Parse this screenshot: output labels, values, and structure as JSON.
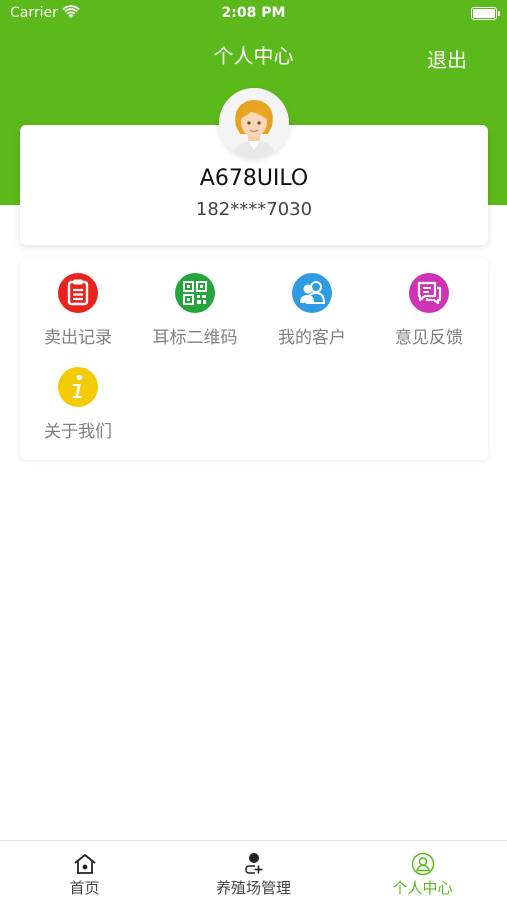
{
  "status_bar": {
    "carrier": "Carrier",
    "time": "2:08 PM"
  },
  "header": {
    "title": "个人中心",
    "logout_label": "退出",
    "color": "#5cb91b"
  },
  "profile": {
    "avatar_icon": "user-avatar-icon",
    "username": "A678UILO",
    "phone": "182****7030"
  },
  "menu": {
    "items": [
      {
        "label": "卖出记录",
        "icon": "clipboard-icon",
        "color": "#e8241c"
      },
      {
        "label": "耳标二维码",
        "icon": "qrcode-icon",
        "color": "#27a53d"
      },
      {
        "label": "我的客户",
        "icon": "customers-icon",
        "color": "#2e9be3"
      },
      {
        "label": "意见反馈",
        "icon": "feedback-icon",
        "color": "#d033b8"
      },
      {
        "label": "关于我们",
        "icon": "info-icon",
        "color": "#f2cb05"
      }
    ]
  },
  "tabbar": {
    "tabs": [
      {
        "label": "首页",
        "icon": "home-icon",
        "active": false
      },
      {
        "label": "养殖场管理",
        "icon": "farm-manage-icon",
        "active": false
      },
      {
        "label": "个人中心",
        "icon": "profile-icon",
        "active": true
      }
    ],
    "active_color": "#5cb91b"
  }
}
